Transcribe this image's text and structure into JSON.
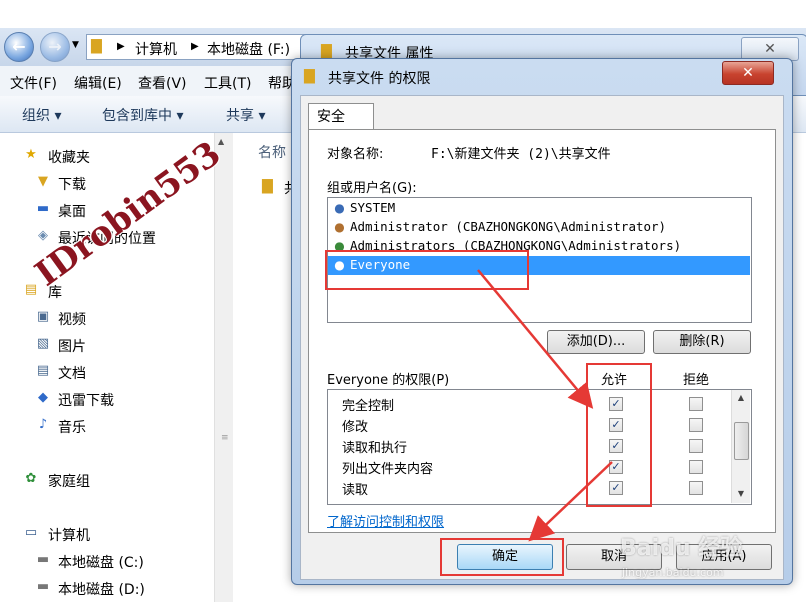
{
  "explorer": {
    "breadcrumb": [
      "计算机",
      "本地磁盘 (F:)"
    ],
    "menu": [
      "文件(F)",
      "编辑(E)",
      "查看(V)",
      "工具(T)",
      "帮助"
    ],
    "toolbar": [
      "组织 ▾",
      "包含到库中 ▾",
      "共享 ▾"
    ],
    "column_header": "名称",
    "content_item": "共",
    "nav": {
      "favorites": "收藏夹",
      "downloads": "下载",
      "desktop": "桌面",
      "recent": "最近访问的位置",
      "library": "库",
      "videos": "视频",
      "pictures": "图片",
      "documents": "文档",
      "thunder": "迅雷下载",
      "music": "音乐",
      "homegroup": "家庭组",
      "computer": "计算机",
      "drive_c": "本地磁盘 (C:)",
      "drive_d": "本地磁盘 (D:)"
    }
  },
  "properties_window": {
    "title": "共享文件 属性",
    "close": "✕"
  },
  "dialog": {
    "title": "共享文件 的权限",
    "close": "✕",
    "tab": "安全",
    "object_label": "对象名称:",
    "object_value": "F:\\新建文件夹 (2)\\共享文件",
    "group_label": "组或用户名(G):",
    "users": [
      "SYSTEM",
      "Administrator (CBAZHONGKONG\\Administrator)",
      "Administrators (CBAZHONGKONG\\Administrators)",
      "Everyone"
    ],
    "selected_user_index": 3,
    "add_button": "添加(D)...",
    "remove_button": "删除(R)",
    "perm_label": "Everyone 的权限(P)",
    "allow_header": "允许",
    "deny_header": "拒绝",
    "permissions": [
      {
        "name": "完全控制",
        "allow": true,
        "deny": false
      },
      {
        "name": "修改",
        "allow": true,
        "deny": false
      },
      {
        "name": "读取和执行",
        "allow": true,
        "deny": false
      },
      {
        "name": "列出文件夹内容",
        "allow": true,
        "deny": false
      },
      {
        "name": "读取",
        "allow": true,
        "deny": false
      }
    ],
    "link": "了解访问控制和权限",
    "ok": "确定",
    "cancel": "取消",
    "apply": "应用(A)"
  },
  "watermark": {
    "id": "IDrobin553",
    "baidu": "Baidu 经验",
    "url": "jingyan.baidu.com"
  },
  "colors": {
    "highlight": "#e53935",
    "selection": "#3399ff",
    "link": "#0066cc"
  }
}
